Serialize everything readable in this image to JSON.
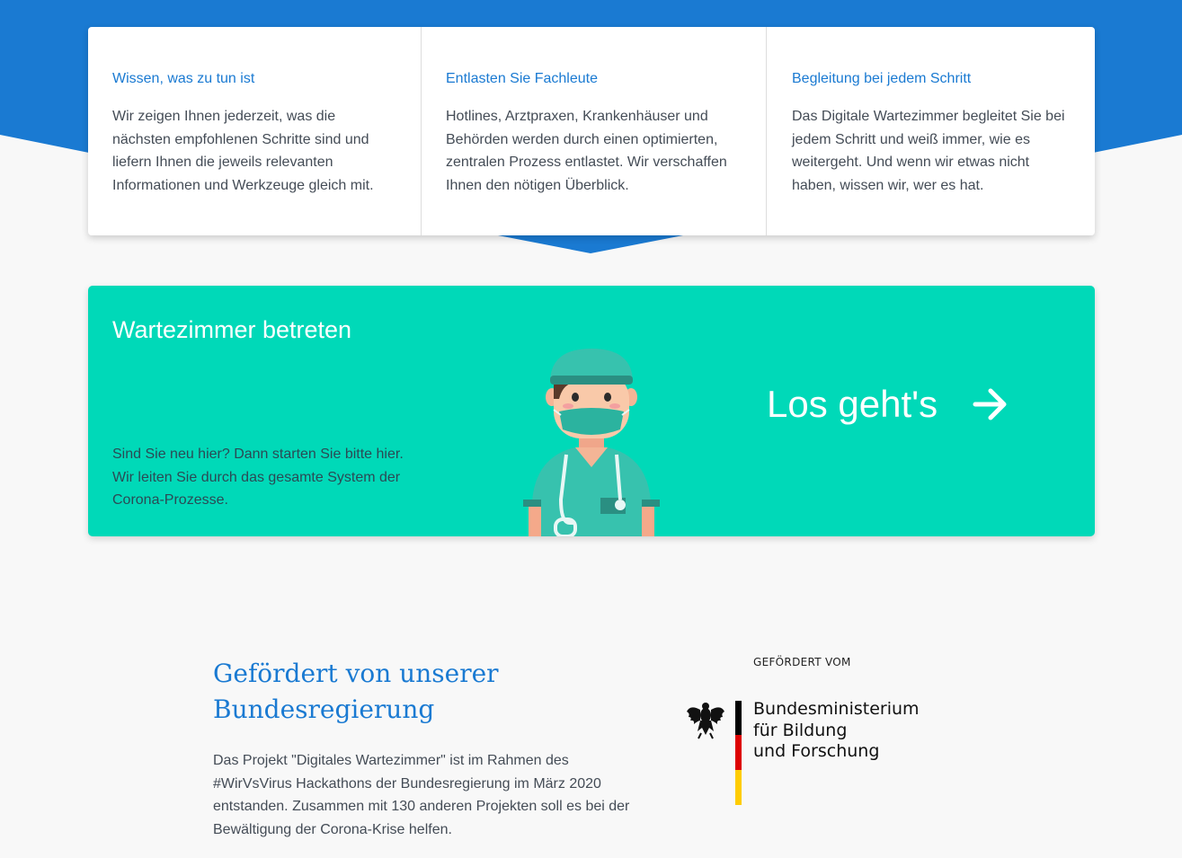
{
  "theme": {
    "accent_blue": "#1a7ad2",
    "teal": "#00d9b8",
    "background": "#f8f8f8"
  },
  "features": [
    {
      "title": "Wissen, was zu tun ist",
      "text": "Wir zeigen Ihnen jederzeit, was die nächsten empfohlenen Schritte sind und liefern Ihnen die jeweils relevanten Informationen und Werkzeuge gleich mit."
    },
    {
      "title": "Entlasten Sie Fachleute",
      "text": "Hotlines, Arztpraxen, Krankenhäuser und Behörden werden durch einen optimierten, zentralen Prozess entlastet. Wir verschaffen Ihnen den nötigen Überblick."
    },
    {
      "title": "Begleitung bei jedem Schritt",
      "text": "Das Digitale Wartezimmer begleitet Sie bei jedem Schritt und weiß immer, wie es weitergeht. Und wenn wir etwas nicht haben, wissen wir, wer es hat."
    }
  ],
  "cta": {
    "title": "Wartezimmer betreten",
    "text": "Sind Sie neu hier? Dann starten Sie bitte hier. Wir leiten Sie durch das gesamte System der Corona-Prozesse.",
    "button_label": "Los geht's",
    "arrow_icon": "arrow-right-icon",
    "illustration": "doctor-illustration"
  },
  "promo": {
    "title": "Gefördert von unserer Bundesregierung",
    "text": "Das Projekt \"Digitales Wartezimmer\" ist im Rahmen des #WirVsVirus Hackathons der Bundesregierung im März 2020 entstanden. Zusammen mit 130 anderen Projekten soll es bei der Bewältigung der Corona-Krise helfen."
  },
  "sponsor": {
    "caption": "GEFÖRDERT VOM",
    "ministry_lines": [
      "Bundesministerium",
      "für Bildung",
      "und Forschung"
    ],
    "flag_colors": [
      "#000000",
      "#dd0000",
      "#ffcc00"
    ]
  }
}
